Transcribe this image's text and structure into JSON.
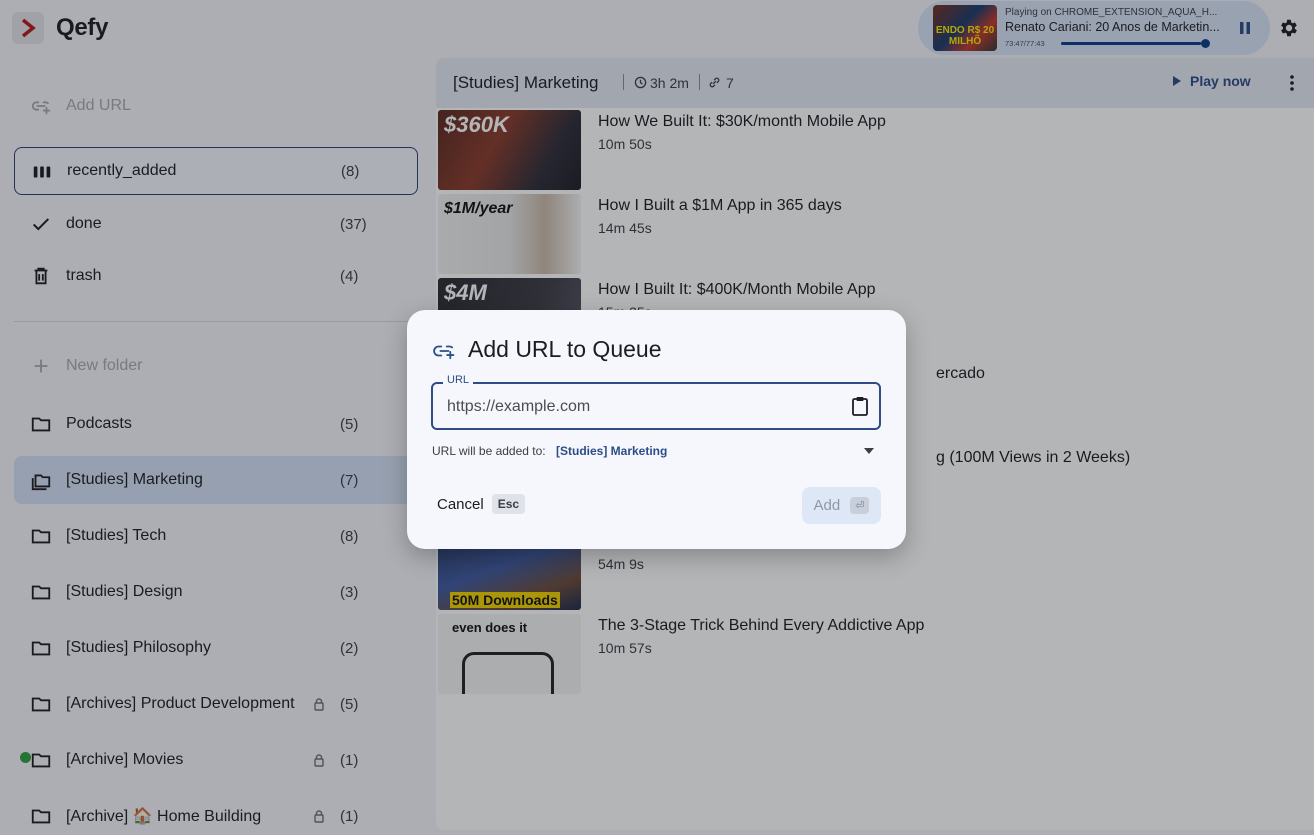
{
  "app": {
    "name": "Qefy"
  },
  "player": {
    "subtitle": "Playing on CHROME_EXTENSION_AQUA_H...",
    "title": "Renato Cariani: 20 Anos de Marketin...",
    "time": "73:47/77:43",
    "progress": 0.95,
    "thumb_text": "ENDO R$ 20 MILHÕ"
  },
  "sidebar": {
    "add_url": "Add URL",
    "queues": [
      {
        "label": "recently_added",
        "count": "(8)",
        "icon": "bars-icon"
      },
      {
        "label": "done",
        "count": "(37)",
        "icon": "check-icon"
      },
      {
        "label": "trash",
        "count": "(4)",
        "icon": "trash-icon"
      }
    ],
    "new_folder": "New folder",
    "folders": [
      {
        "label": "Podcasts",
        "count": "(5)"
      },
      {
        "label": "[Studies] Marketing",
        "count": "(7)"
      },
      {
        "label": "[Studies] Tech",
        "count": "(8)"
      },
      {
        "label": "[Studies] Design",
        "count": "(3)"
      },
      {
        "label": "[Studies] Philosophy",
        "count": "(2)"
      },
      {
        "label": "[Archives] Product Development",
        "count": "(5)"
      },
      {
        "label": "[Archive] Movies",
        "count": "(1)"
      },
      {
        "label": "[Archive] 🏠 Home Building",
        "count": "(1)"
      }
    ]
  },
  "main": {
    "title": "[Studies] Marketing",
    "duration": "3h 2m",
    "count": "7",
    "play_now": "Play now",
    "items": [
      {
        "title": "How We Built It: $30K/month Mobile App",
        "duration": "10m 50s",
        "thumb_text": "$360K"
      },
      {
        "title": "How I Built a $1M App in 365 days",
        "duration": "14m 45s",
        "thumb_text": "$1M/year"
      },
      {
        "title": "How I Built It: $400K/Month Mobile App",
        "duration": "15m 35s",
        "thumb_text": "$4M"
      },
      {
        "title": "ercado",
        "duration": ""
      },
      {
        "title": "g (100M Views in 2 Weeks)",
        "duration": ""
      },
      {
        "title": "",
        "duration": "54m 9s",
        "thumb_text": "50M Downloads"
      },
      {
        "title": "The 3-Stage Trick Behind Every Addictive App",
        "duration": "10m 57s",
        "thumb_text": "even  does it"
      }
    ]
  },
  "dialog": {
    "title": "Add URL to Queue",
    "field_label": "URL",
    "placeholder": "https://example.com",
    "target_label": "URL will be added to:",
    "target_value": "[Studies] Marketing",
    "cancel": "Cancel",
    "cancel_key": "Esc",
    "add": "Add",
    "add_key": "⏎"
  },
  "colors": {
    "accent": "#2c4d86",
    "active_bg": "#d5e1f5",
    "player_bg": "#d8e3f6",
    "status_online": "#2e9e3e"
  }
}
